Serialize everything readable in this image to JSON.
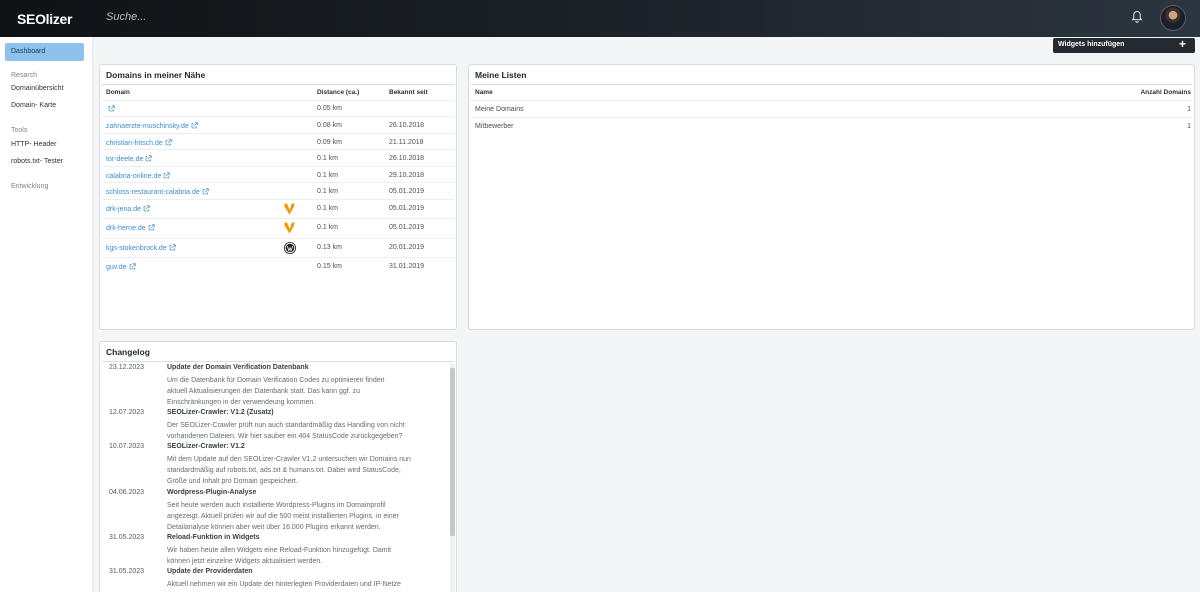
{
  "header": {
    "logo": "SEOlizer",
    "search_placeholder": "Suche..."
  },
  "sidebar": {
    "active": "Dashboard",
    "sections": [
      {
        "label": "Resarch",
        "items": [
          "Domainübersicht",
          "Domain- Karte"
        ]
      },
      {
        "label": "Tools",
        "items": [
          "HTTP- Header",
          "robots.txt- Tester"
        ]
      },
      {
        "label": "Entwicklung",
        "items": []
      }
    ]
  },
  "widgets_button": {
    "label": "Widgets hinzufügen",
    "plus": "+"
  },
  "nearby": {
    "title": "Domains in meiner Nähe",
    "headers": {
      "domain": "Domain",
      "distance": "Distance (ca.)",
      "since": "Bekannt seit"
    },
    "rows": [
      {
        "domain": "",
        "cms": "",
        "distance": "0.05 km",
        "since": ""
      },
      {
        "domain": "zahnaerzte-muschinsky.de",
        "cms": "",
        "distance": "0.08 km",
        "since": "26.10.2018"
      },
      {
        "domain": "christian-fritsch.de",
        "cms": "",
        "distance": "0.09 km",
        "since": "21.11.2018"
      },
      {
        "domain": "tor-deele.de",
        "cms": "",
        "distance": "0.1 km",
        "since": "26.10.2018"
      },
      {
        "domain": "calabria-online.de",
        "cms": "",
        "distance": "0.1 km",
        "since": "29.10.2018"
      },
      {
        "domain": "schloss-restaurant-calabria.de",
        "cms": "",
        "distance": "0.1 km",
        "since": "05.01.2019"
      },
      {
        "domain": "drk-jena.de",
        "cms": "typo3",
        "distance": "0.1 km",
        "since": "05.01.2019"
      },
      {
        "domain": "drk-herne.de",
        "cms": "typo3",
        "distance": "0.1 km",
        "since": "05.01.2019"
      },
      {
        "domain": "kgs-stukenbrock.de",
        "cms": "wordpress",
        "distance": "0.13 km",
        "since": "20.01.2019"
      },
      {
        "domain": "guv.de",
        "cms": "",
        "distance": "0.15 km",
        "since": "31.01.2019"
      }
    ]
  },
  "lists": {
    "title": "Meine Listen",
    "headers": {
      "name": "Name",
      "count": "Anzahl Domains"
    },
    "rows": [
      {
        "name": "Meine Domains",
        "count": "1"
      },
      {
        "name": "Mitbewerber",
        "count": "1"
      }
    ]
  },
  "changelog": {
    "title": "Changelog",
    "entries": [
      {
        "date": "23.12.2023",
        "title": "Update der Domain Verification Datenbank",
        "body": [
          "Um die Datenbank für Domain Verification Codes zu optimieren finden",
          "aktuell Aktualisierungen der Datenbank statt. Das kann ggf. zu",
          "Einschränkungen in der verwendeung kommen."
        ]
      },
      {
        "date": "12.07.2023",
        "title": "SEOLizer-Crawler: V1.2 (Zusatz)",
        "body": [
          "Der SEOLizer-Crawler prüft nun auch standardmäßig das Handling von nicht",
          "vorhandenen Dateien. Wir hier sauber ein 404 StatusCode zurückgegeben?"
        ]
      },
      {
        "date": "10.07.2023",
        "title": "SEOLizer-Crawler: V1.2",
        "body": [
          "Mit dem Update auf den SEOLizer-Crawler V1.2 untersuchen wir Domains nun",
          "standardmäßig auf robots.txt, ads.txt & humans.txt. Dabei wird StatusCode,",
          "Größe und Inhalt pro Domain gespeichert."
        ]
      },
      {
        "date": "04.06.2023",
        "title": "Wordpress-Plugin-Analyse",
        "body": [
          "Seit heute werden auch installierte Wordpress-Plugins im Domainprofil",
          "angezeigt. Aktuell prüfen wir auf die 500 meist installierten Plugins. in einer",
          "Detailanalyse können aber weit über 16.000 Plugins erkannt werden."
        ]
      },
      {
        "date": "31.05.2023",
        "title": "Reload-Funktion in Widgets",
        "body": [
          "Wir haben heute allen Widgets eine Reload-Funktion hinzugefügt. Damit",
          "können jetzt einzelne Widgets aktualisiert werden."
        ]
      },
      {
        "date": "31.05.2023",
        "title": "Update der Providerdaten",
        "body": [
          "Aktuell nehmen wir ein Update der hinterlegten Providerdaten und IP-Netze"
        ]
      }
    ]
  }
}
